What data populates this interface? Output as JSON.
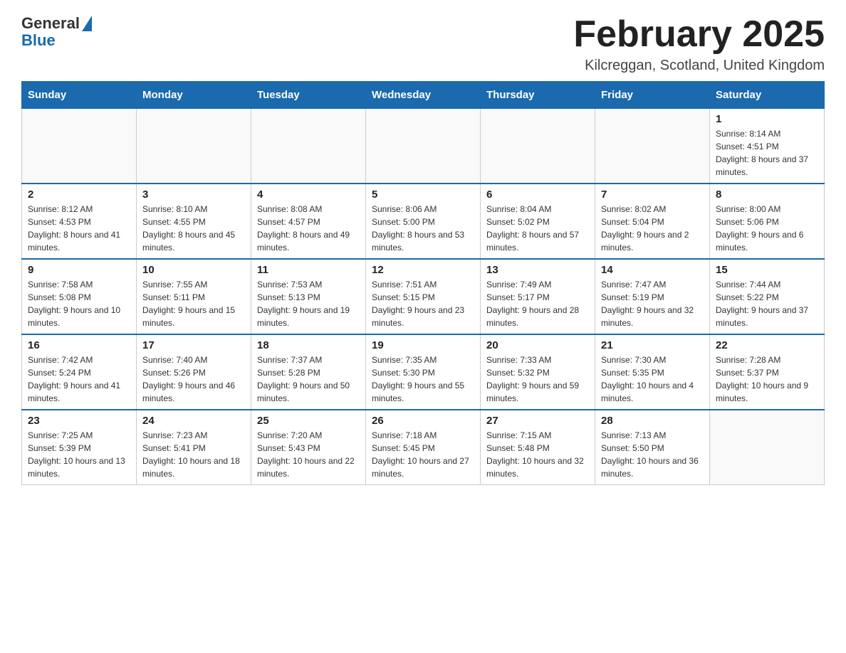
{
  "header": {
    "logo_general": "General",
    "logo_blue": "Blue",
    "month_title": "February 2025",
    "location": "Kilcreggan, Scotland, United Kingdom"
  },
  "days_of_week": [
    "Sunday",
    "Monday",
    "Tuesday",
    "Wednesday",
    "Thursday",
    "Friday",
    "Saturday"
  ],
  "weeks": [
    [
      {
        "day": "",
        "info": ""
      },
      {
        "day": "",
        "info": ""
      },
      {
        "day": "",
        "info": ""
      },
      {
        "day": "",
        "info": ""
      },
      {
        "day": "",
        "info": ""
      },
      {
        "day": "",
        "info": ""
      },
      {
        "day": "1",
        "info": "Sunrise: 8:14 AM\nSunset: 4:51 PM\nDaylight: 8 hours and 37 minutes."
      }
    ],
    [
      {
        "day": "2",
        "info": "Sunrise: 8:12 AM\nSunset: 4:53 PM\nDaylight: 8 hours and 41 minutes."
      },
      {
        "day": "3",
        "info": "Sunrise: 8:10 AM\nSunset: 4:55 PM\nDaylight: 8 hours and 45 minutes."
      },
      {
        "day": "4",
        "info": "Sunrise: 8:08 AM\nSunset: 4:57 PM\nDaylight: 8 hours and 49 minutes."
      },
      {
        "day": "5",
        "info": "Sunrise: 8:06 AM\nSunset: 5:00 PM\nDaylight: 8 hours and 53 minutes."
      },
      {
        "day": "6",
        "info": "Sunrise: 8:04 AM\nSunset: 5:02 PM\nDaylight: 8 hours and 57 minutes."
      },
      {
        "day": "7",
        "info": "Sunrise: 8:02 AM\nSunset: 5:04 PM\nDaylight: 9 hours and 2 minutes."
      },
      {
        "day": "8",
        "info": "Sunrise: 8:00 AM\nSunset: 5:06 PM\nDaylight: 9 hours and 6 minutes."
      }
    ],
    [
      {
        "day": "9",
        "info": "Sunrise: 7:58 AM\nSunset: 5:08 PM\nDaylight: 9 hours and 10 minutes."
      },
      {
        "day": "10",
        "info": "Sunrise: 7:55 AM\nSunset: 5:11 PM\nDaylight: 9 hours and 15 minutes."
      },
      {
        "day": "11",
        "info": "Sunrise: 7:53 AM\nSunset: 5:13 PM\nDaylight: 9 hours and 19 minutes."
      },
      {
        "day": "12",
        "info": "Sunrise: 7:51 AM\nSunset: 5:15 PM\nDaylight: 9 hours and 23 minutes."
      },
      {
        "day": "13",
        "info": "Sunrise: 7:49 AM\nSunset: 5:17 PM\nDaylight: 9 hours and 28 minutes."
      },
      {
        "day": "14",
        "info": "Sunrise: 7:47 AM\nSunset: 5:19 PM\nDaylight: 9 hours and 32 minutes."
      },
      {
        "day": "15",
        "info": "Sunrise: 7:44 AM\nSunset: 5:22 PM\nDaylight: 9 hours and 37 minutes."
      }
    ],
    [
      {
        "day": "16",
        "info": "Sunrise: 7:42 AM\nSunset: 5:24 PM\nDaylight: 9 hours and 41 minutes."
      },
      {
        "day": "17",
        "info": "Sunrise: 7:40 AM\nSunset: 5:26 PM\nDaylight: 9 hours and 46 minutes."
      },
      {
        "day": "18",
        "info": "Sunrise: 7:37 AM\nSunset: 5:28 PM\nDaylight: 9 hours and 50 minutes."
      },
      {
        "day": "19",
        "info": "Sunrise: 7:35 AM\nSunset: 5:30 PM\nDaylight: 9 hours and 55 minutes."
      },
      {
        "day": "20",
        "info": "Sunrise: 7:33 AM\nSunset: 5:32 PM\nDaylight: 9 hours and 59 minutes."
      },
      {
        "day": "21",
        "info": "Sunrise: 7:30 AM\nSunset: 5:35 PM\nDaylight: 10 hours and 4 minutes."
      },
      {
        "day": "22",
        "info": "Sunrise: 7:28 AM\nSunset: 5:37 PM\nDaylight: 10 hours and 9 minutes."
      }
    ],
    [
      {
        "day": "23",
        "info": "Sunrise: 7:25 AM\nSunset: 5:39 PM\nDaylight: 10 hours and 13 minutes."
      },
      {
        "day": "24",
        "info": "Sunrise: 7:23 AM\nSunset: 5:41 PM\nDaylight: 10 hours and 18 minutes."
      },
      {
        "day": "25",
        "info": "Sunrise: 7:20 AM\nSunset: 5:43 PM\nDaylight: 10 hours and 22 minutes."
      },
      {
        "day": "26",
        "info": "Sunrise: 7:18 AM\nSunset: 5:45 PM\nDaylight: 10 hours and 27 minutes."
      },
      {
        "day": "27",
        "info": "Sunrise: 7:15 AM\nSunset: 5:48 PM\nDaylight: 10 hours and 32 minutes."
      },
      {
        "day": "28",
        "info": "Sunrise: 7:13 AM\nSunset: 5:50 PM\nDaylight: 10 hours and 36 minutes."
      },
      {
        "day": "",
        "info": ""
      }
    ]
  ]
}
